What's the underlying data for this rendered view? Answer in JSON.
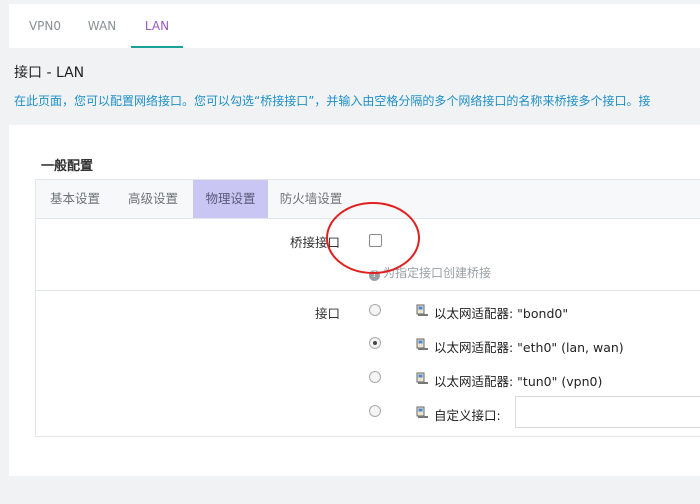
{
  "tabs": [
    {
      "label": "VPN0"
    },
    {
      "label": "WAN"
    },
    {
      "label": "LAN"
    }
  ],
  "page": {
    "title": "接口 - LAN",
    "description": "在此页面，您可以配置网络接口。您可以勾选“桥接接口”，并输入由空格分隔的多个网络接口的名称来桥接多个接口。接"
  },
  "section": {
    "title": "一般配置",
    "subtabs": [
      {
        "label": "基本设置"
      },
      {
        "label": "高级设置"
      },
      {
        "label": "物理设置"
      },
      {
        "label": "防火墙设置"
      }
    ]
  },
  "bridge": {
    "label": "桥接接口",
    "help": "为指定接口创建桥接",
    "checked": false
  },
  "interface": {
    "label": "接口",
    "options": [
      {
        "label": "以太网适配器: \"bond0\"",
        "checked": false
      },
      {
        "label": "以太网适配器: \"eth0\" (lan, wan)",
        "checked": true
      },
      {
        "label": "以太网适配器: \"tun0\" (vpn0)",
        "checked": false
      },
      {
        "label": "自定义接口:",
        "checked": false
      }
    ],
    "custom_value": ""
  },
  "colors": {
    "active_tab_text": "#9a5bbf",
    "active_tab_underline": "#1aa39a",
    "description_text": "#1e90c8",
    "active_subtab_bg": "#c9c6f3",
    "annotation_circle": "#e02020"
  },
  "icons": {
    "help": "question-circle-icon",
    "adapter": "network-adapter-icon"
  }
}
